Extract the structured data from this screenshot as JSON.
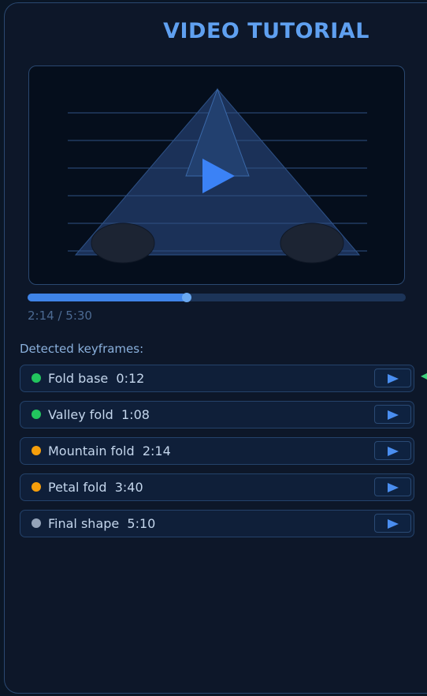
{
  "header": {
    "title": "VIDEO TUTORIAL"
  },
  "player": {
    "progress_fraction": 0.42,
    "timecode": "2:14 / 5:30",
    "accent": "#3f84e8"
  },
  "keyframes": {
    "label": "Detected keyframes:",
    "items": [
      {
        "name": "Fold base",
        "time": "0:12",
        "display": "Fold base  0:12",
        "status_color": "#22c55e"
      },
      {
        "name": "Valley fold",
        "time": "1:08",
        "display": "Valley fold  1:08",
        "status_color": "#22c55e"
      },
      {
        "name": "Mountain fold",
        "time": "2:14",
        "display": "Mountain fold  2:14",
        "status_color": "#f59e0b"
      },
      {
        "name": "Petal fold",
        "time": "3:40",
        "display": "Petal fold  3:40",
        "status_color": "#f59e0b"
      },
      {
        "name": "Final shape",
        "time": "5:10",
        "display": "Final shape  5:10",
        "status_color": "#94a3b8"
      }
    ]
  },
  "icons": {
    "play": "play-icon",
    "row_play": "play-icon",
    "edge": "arrow-left-icon"
  }
}
